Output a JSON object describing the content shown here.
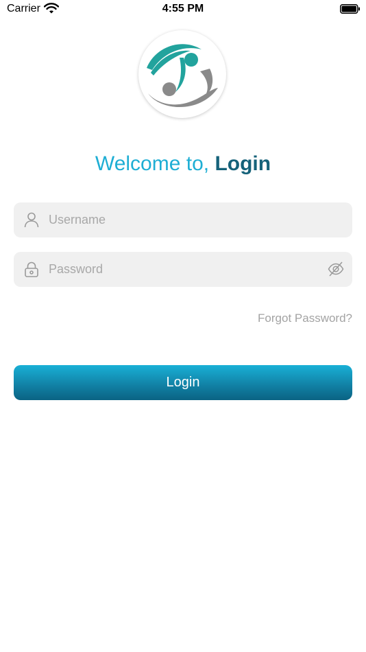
{
  "status_bar": {
    "carrier": "Carrier",
    "time": "4:55 PM"
  },
  "welcome": {
    "prefix": "Welcome to, ",
    "emphasis": "Login"
  },
  "username": {
    "placeholder": "Username",
    "value": "",
    "icon": "user-icon"
  },
  "password": {
    "placeholder": "Password",
    "value": "",
    "icon": "lock-icon",
    "toggle_icon": "eye-off-icon"
  },
  "forgot_password_label": "Forgot Password?",
  "login_button_label": "Login",
  "colors": {
    "accent": "#1eaed4",
    "accent_dark": "#15627a",
    "logo_teal": "#22a39d",
    "logo_gray": "#8a8a8a",
    "field_bg": "#f0f0f0",
    "placeholder": "#a8a8a8"
  }
}
